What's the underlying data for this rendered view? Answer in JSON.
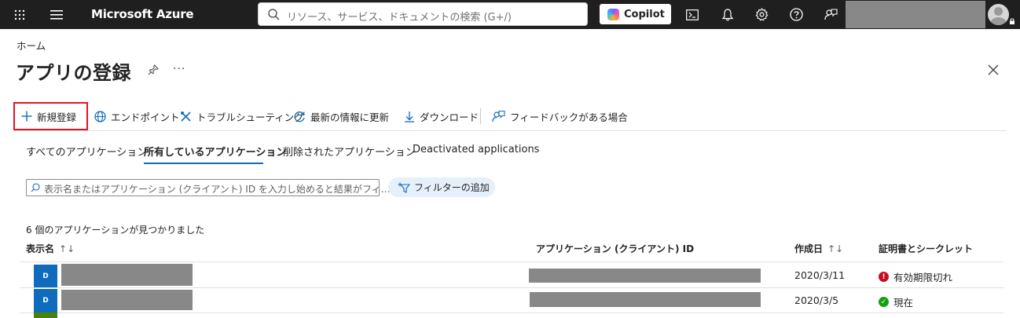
{
  "topbar": {
    "brand": "Microsoft Azure",
    "search_placeholder": "リソース、サービス、ドキュメントの検索 (G+/)",
    "copilot_label": "Copilot",
    "icons": [
      "waffle-icon",
      "hamburger-icon",
      "cloud-shell-icon",
      "bell-icon",
      "gear-icon",
      "help-icon",
      "feedback-icon"
    ]
  },
  "breadcrumb": "ホーム",
  "page": {
    "title": "アプリの登録",
    "more": "···"
  },
  "toolbar": {
    "new_registration": "新規登録",
    "endpoints": "エンドポイント",
    "troubleshooting": "トラブルシューティング",
    "refresh": "最新の情報に更新",
    "download": "ダウンロード",
    "feedback": "フィードバックがある場合"
  },
  "tabs": [
    {
      "label": "すべてのアプリケーション",
      "active": false
    },
    {
      "label": "所有しているアプリケーション",
      "active": true
    },
    {
      "label": "削除されたアプリケーション",
      "active": false
    },
    {
      "label": "Deactivated applications",
      "active": false
    }
  ],
  "filter": {
    "placeholder": "表示名またはアプリケーション (クライアント) ID を入力し始めると結果がフィ…",
    "add_filter": "フィルターの追加"
  },
  "table": {
    "count_text": "6 個のアプリケーションが見つかりました",
    "headers": {
      "display_name": "表示名",
      "app_id": "アプリケーション (クライアント) ID",
      "created": "作成日",
      "certs": "証明書とシークレット",
      "sort_both": "↑↓"
    },
    "rows": [
      {
        "badge": "D",
        "created": "2020/3/11",
        "status": "有効期限切れ",
        "status_type": "error",
        "status_glyph": "!"
      },
      {
        "badge": "D",
        "created": "2020/3/5",
        "status": "現在",
        "status_type": "ok",
        "status_glyph": "✓"
      }
    ]
  },
  "colors": {
    "topbar": "#1f1f1f",
    "accent": "#0f6cbd",
    "highlight_border": "#e81123",
    "error": "#c50f1f",
    "success": "#13a10e"
  }
}
